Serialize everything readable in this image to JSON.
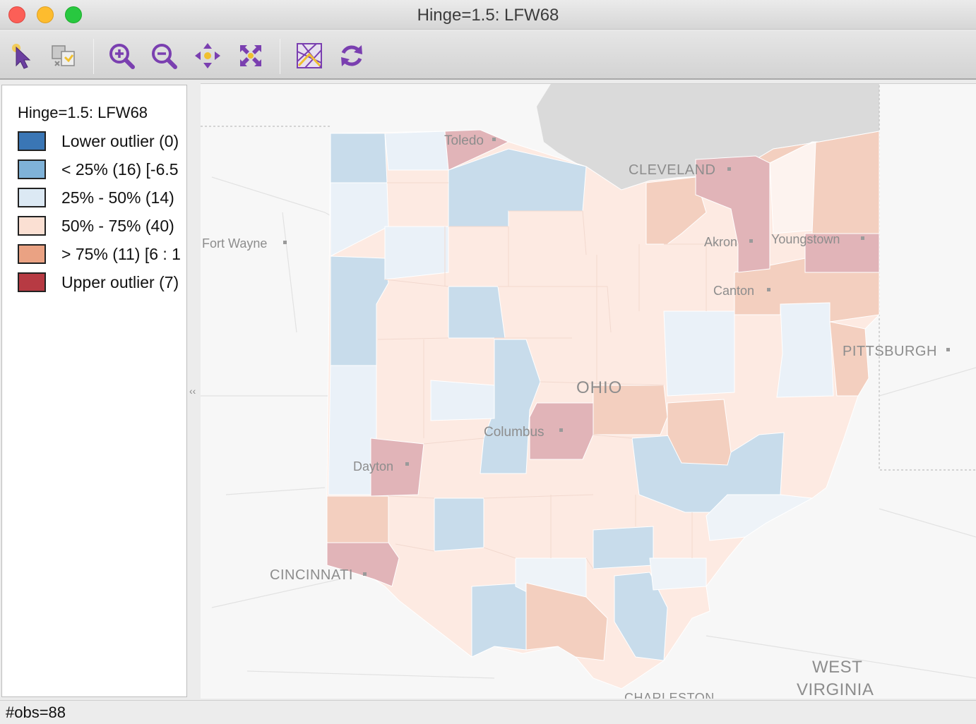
{
  "window": {
    "title": "Hinge=1.5: LFW68"
  },
  "toolbar": {
    "buttons": [
      {
        "icon": "select-pointer-icon"
      },
      {
        "icon": "copy-image-icon"
      },
      {
        "icon": "zoom-in-icon"
      },
      {
        "icon": "zoom-out-icon"
      },
      {
        "icon": "pan-icon"
      },
      {
        "icon": "fit-extent-icon"
      },
      {
        "icon": "basemap-icon"
      },
      {
        "icon": "refresh-icon"
      }
    ]
  },
  "legend": {
    "title": "Hinge=1.5: LFW68",
    "items": [
      {
        "label": "Lower outlier (0)",
        "color": "#3a76b5"
      },
      {
        "label": "< 25% (16)  [-6.5",
        "color": "#7fb2d8"
      },
      {
        "label": "25% - 50% (14)",
        "color": "#dce9f4"
      },
      {
        "label": "50% - 75% (40)",
        "color": "#fbe0d3"
      },
      {
        "label": "> 75% (11)  [6 : 1",
        "color": "#eaa283"
      },
      {
        "label": "Upper outlier (7)",
        "color": "#b73a43"
      }
    ]
  },
  "map": {
    "labels": {
      "toledo": "Toledo",
      "cleveland": "CLEVELAND",
      "fort_wayne": "Fort Wayne",
      "akron": "Akron",
      "youngstown": "Youngstown",
      "canton": "Canton",
      "pittsburgh": "PITTSBURGH",
      "ohio": "OHIO",
      "columbus": "Columbus",
      "dayton": "Dayton",
      "cincinnati": "CINCINNATI",
      "west": "WEST",
      "virginia": "VIRGINIA",
      "charleston": "CHARLESTON"
    }
  },
  "status": {
    "text": "#obs=88"
  }
}
